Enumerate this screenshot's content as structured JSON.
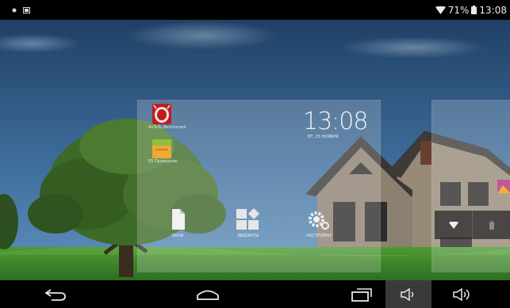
{
  "status_bar": {
    "battery_percent": "71%",
    "time": "13:08",
    "icons": [
      "notification-dot-icon",
      "screenshot-icon",
      "wifi-icon",
      "battery-icon"
    ]
  },
  "home_screen_widget": {
    "clock_time": "13:08",
    "clock_date": "ВТ, 25 НОЯБРЯ",
    "apps": [
      {
        "label": "AnTuTu Benchmark",
        "icon": "antutu-icon"
      },
      {
        "label": "ES Проводник",
        "icon": "file-manager-icon"
      }
    ],
    "tray": [
      {
        "label": "ОБОИ",
        "icon": "wallpaper-icon"
      },
      {
        "label": "ВИДЖЕТЫ",
        "icon": "widgets-icon"
      },
      {
        "label": "НАСТРОЙКИ",
        "icon": "settings-icon"
      }
    ]
  },
  "quick_panel": {
    "icons": [
      "wifi-icon",
      "battery-icon"
    ]
  },
  "nav_bar": {
    "buttons": [
      "back-icon",
      "home-icon",
      "recents-icon",
      "volume-down-icon",
      "volume-up-icon"
    ]
  },
  "colors": {
    "status_bar": "#000000",
    "nav_bar": "#000000",
    "sky_top": "#1c3a5e",
    "sky_bottom": "#4d82b0",
    "grass": "#3f8a2e",
    "panel_overlay": "rgba(255,255,255,0.2)"
  }
}
